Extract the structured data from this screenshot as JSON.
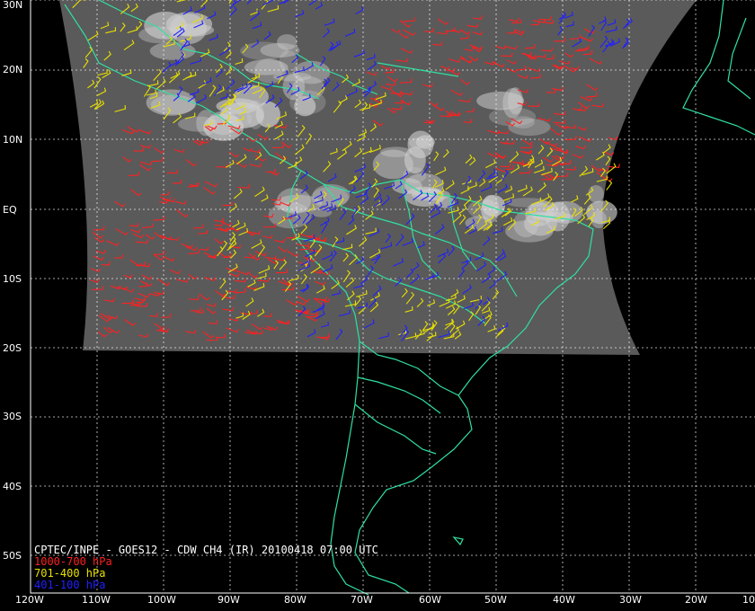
{
  "title": "CPTEC/INPE - GOES12 - CDW CH4 (IR) 20100418 07:00 UTC",
  "legend": [
    {
      "label": "1000-700 hPa",
      "color": "#ff2020"
    },
    {
      "label": "701-400 hPa",
      "color": "#e8e000"
    },
    {
      "label": "401-100 hPa",
      "color": "#2020ff"
    }
  ],
  "lat_labels": [
    "30N",
    "20N",
    "10N",
    "EQ",
    "10S",
    "20S",
    "30S",
    "40S",
    "50S"
  ],
  "lon_labels": [
    "120W",
    "110W",
    "100W",
    "90W",
    "80W",
    "70W",
    "60W",
    "50W",
    "40W",
    "30W",
    "20W",
    "10"
  ],
  "colors": {
    "coast": "#30e0a0",
    "grid": "#ffffff",
    "background": "#000000"
  }
}
